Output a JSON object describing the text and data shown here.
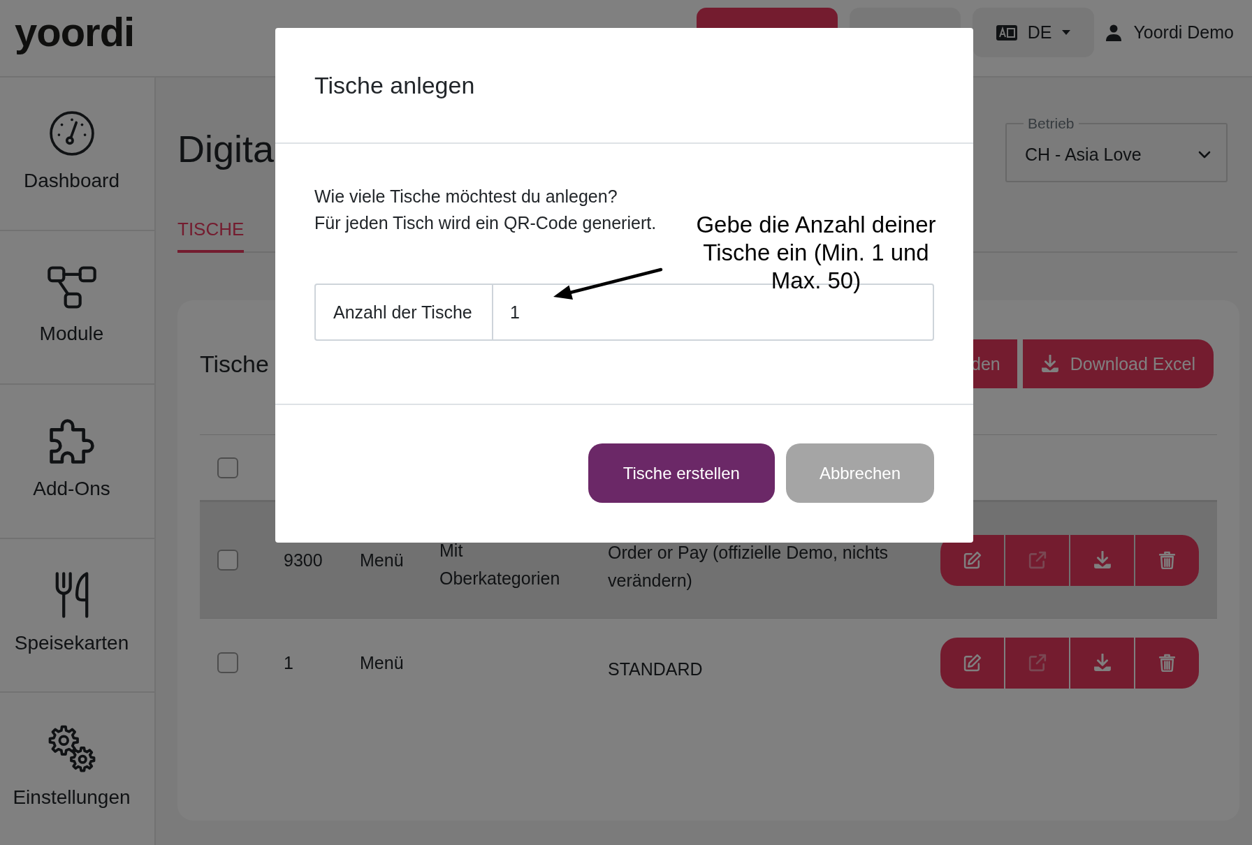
{
  "header": {
    "logo": "yoordi",
    "language": {
      "code": "DE"
    },
    "user": {
      "name": "Yoordi Demo"
    }
  },
  "sidebar": {
    "items": [
      {
        "kind": "dashboard",
        "label": "Dashboard"
      },
      {
        "kind": "modules",
        "label": "Module"
      },
      {
        "kind": "addons",
        "label": "Add-Ons"
      },
      {
        "kind": "menus",
        "label": "Speisekarten"
      },
      {
        "kind": "settings",
        "label": "Einstellungen"
      }
    ]
  },
  "page": {
    "title": "Digita",
    "location_select": {
      "label": "Betrieb",
      "value": "CH - Asia Love"
    },
    "tabs": [
      {
        "label": "TISCHE",
        "selected": true
      }
    ],
    "card": {
      "title": "Tische",
      "buttons": [
        {
          "kind": "plain",
          "label": "den"
        },
        {
          "kind": "download",
          "label": "Download Excel"
        }
      ],
      "table": {
        "select_all": {
          "checked": false
        },
        "rows": [
          {
            "checked": false,
            "highlighted": true,
            "column_2": "9300",
            "column_3": "Menü",
            "column_4": "Mit Oberkategorien",
            "column_5": "Order or Pay (offizielle Demo, nichts verändern)"
          },
          {
            "checked": false,
            "highlighted": false,
            "column_2": "1",
            "column_3": "Menü",
            "column_5": "STANDARD"
          }
        ]
      }
    }
  },
  "dialog": {
    "title": "Tische anlegen",
    "text": [
      "Wie viele Tische möchtest du anlegen?",
      "Für jeden Tisch wird ein QR-Code generiert."
    ],
    "field": {
      "label": "Anzahl der Tische",
      "value": "1"
    },
    "buttons": [
      {
        "kind": "primary",
        "label": "Tische erstellen"
      },
      {
        "kind": "secondary",
        "label": "Abbrechen"
      }
    ]
  },
  "annotation": {
    "text": "Gebe die Anzahl deiner Tische ein (Min. 1 und Max. 50)"
  }
}
